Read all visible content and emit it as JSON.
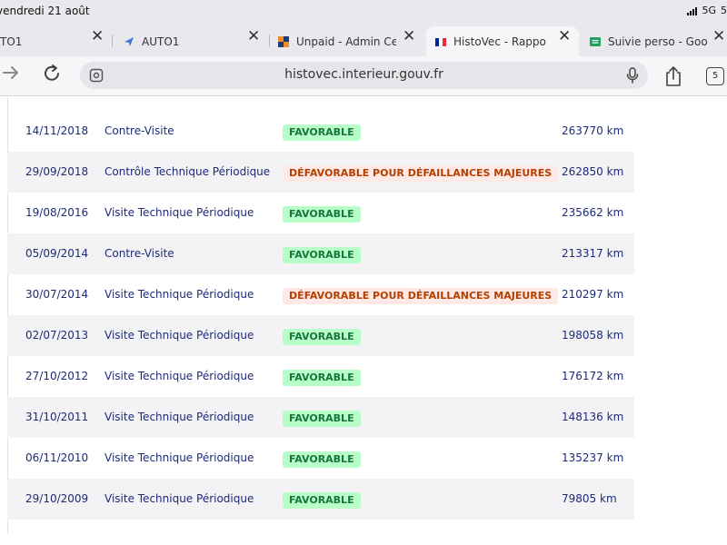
{
  "status_bar": {
    "time": "vendredi 21 août",
    "network": "5G",
    "battery_text": "5"
  },
  "tabs": [
    {
      "title": "TO1",
      "active": false,
      "icon": "page-icon"
    },
    {
      "title": "AUTO1",
      "active": false,
      "icon": "auto1-logo-icon"
    },
    {
      "title": "Unpaid - Admin Cen",
      "active": false,
      "icon": "admin-logo-icon"
    },
    {
      "title": "HistoVec - Rapport v",
      "active": true,
      "icon": "french-flag-icon"
    },
    {
      "title": "Suivie perso - Goog",
      "active": false,
      "icon": "google-sheets-icon"
    }
  ],
  "toolbar": {
    "url": "histovec.interieur.gouv.fr",
    "tab_count": "5"
  },
  "table": {
    "rows": [
      {
        "date": "14/11/2018",
        "type": "Contre-Visite",
        "result": "FAVORABLE",
        "status": "ok",
        "km": "263770 km"
      },
      {
        "date": "29/09/2018",
        "type": "Contrôle Technique Périodique",
        "result": "DÉFAVORABLE POUR DÉFAILLANCES MAJEURES",
        "status": "ko",
        "km": "262850 km"
      },
      {
        "date": "19/08/2016",
        "type": "Visite Technique Périodique",
        "result": "FAVORABLE",
        "status": "ok",
        "km": "235662 km"
      },
      {
        "date": "05/09/2014",
        "type": "Contre-Visite",
        "result": "FAVORABLE",
        "status": "ok",
        "km": "213317 km"
      },
      {
        "date": "30/07/2014",
        "type": "Visite Technique Périodique",
        "result": "DÉFAVORABLE POUR DÉFAILLANCES MAJEURES",
        "status": "ko",
        "km": "210297 km"
      },
      {
        "date": "02/07/2013",
        "type": "Visite Technique Périodique",
        "result": "FAVORABLE",
        "status": "ok",
        "km": "198058 km"
      },
      {
        "date": "27/10/2012",
        "type": "Visite Technique Périodique",
        "result": "FAVORABLE",
        "status": "ok",
        "km": "176172 km"
      },
      {
        "date": "31/10/2011",
        "type": "Visite Technique Périodique",
        "result": "FAVORABLE",
        "status": "ok",
        "km": "148136 km"
      },
      {
        "date": "06/11/2010",
        "type": "Visite Technique Périodique",
        "result": "FAVORABLE",
        "status": "ok",
        "km": "135237 km"
      },
      {
        "date": "29/10/2009",
        "type": "Visite Technique Périodique",
        "result": "FAVORABLE",
        "status": "ok",
        "km": "79805 km"
      }
    ]
  },
  "colors": {
    "favorable_bg": "#b8fec9",
    "favorable_text": "#18753c",
    "defavorable_bg": "#ffe9e6",
    "defavorable_text": "#b34000",
    "row_text": "#1e2a78"
  }
}
